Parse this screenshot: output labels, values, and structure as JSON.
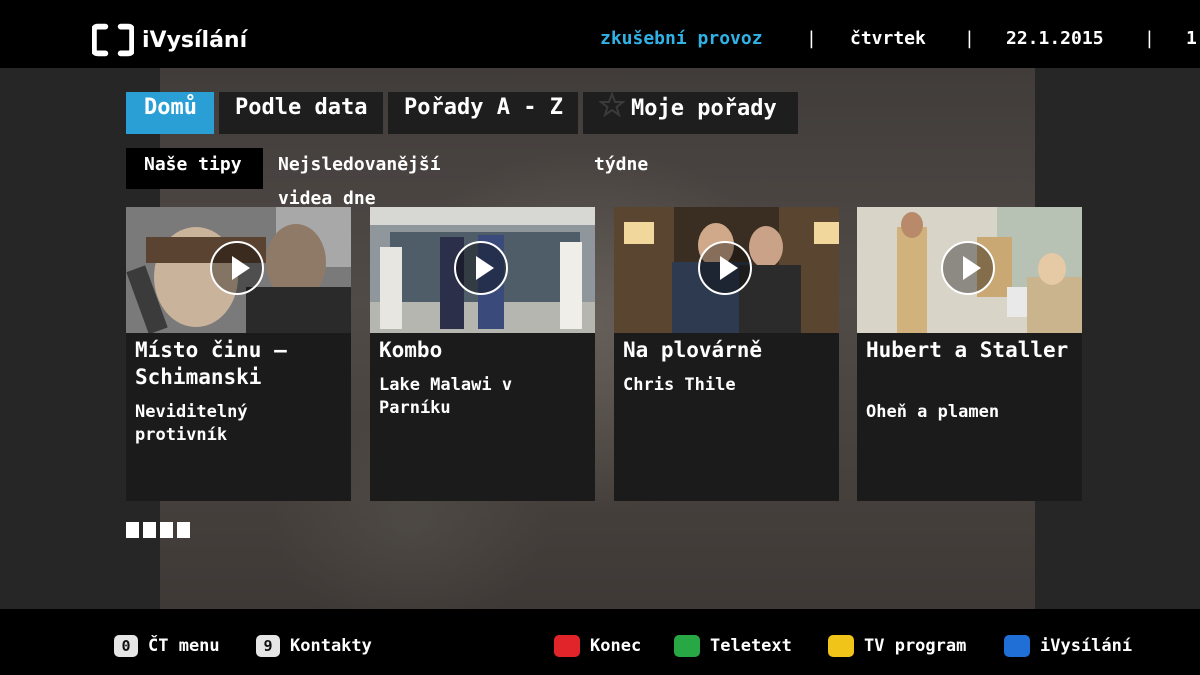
{
  "header": {
    "logo_text": "iVysílání",
    "status_trial": "zkušební provoz",
    "separator": "|",
    "day": "čtvrtek",
    "date": "22.1.2015",
    "time_partial": "1"
  },
  "tabs": [
    {
      "label": "Domů"
    },
    {
      "label": "Podle data"
    },
    {
      "label": "Pořady A - Z"
    },
    {
      "label": "Moje pořady"
    }
  ],
  "subtabs": [
    {
      "label": "Naše tipy"
    },
    {
      "label": "Nejsledovanější videa dne"
    },
    {
      "label": "týdne"
    }
  ],
  "cards": [
    {
      "title": "Místo činu – Schimanski",
      "subtitle": "Neviditelný protivník"
    },
    {
      "title": "Kombo",
      "subtitle": "Lake Malawi v Parníku"
    },
    {
      "title": "Na plovárně",
      "subtitle": "Chris Thile"
    },
    {
      "title": "Hubert a Staller",
      "subtitle": "Oheň a plamen"
    }
  ],
  "pager": {
    "count": 4
  },
  "footer": {
    "keys": [
      {
        "key": "0",
        "label": "ČT menu"
      },
      {
        "key": "9",
        "label": "Kontakty"
      }
    ],
    "color_keys": [
      {
        "color": "#e0242a",
        "label": "Konec"
      },
      {
        "color": "#27a844",
        "label": "Teletext"
      },
      {
        "color": "#f0c419",
        "label": "TV program"
      },
      {
        "color": "#1f6fd6",
        "label": "iVysílání"
      }
    ]
  }
}
